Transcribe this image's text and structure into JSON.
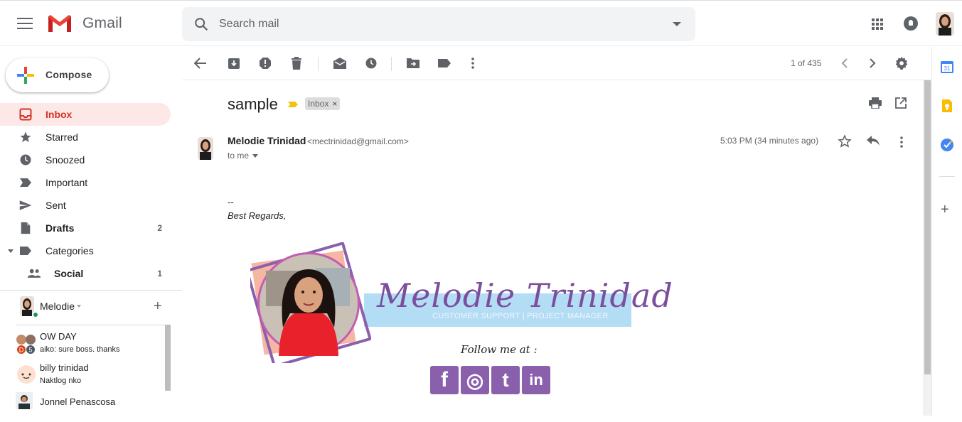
{
  "app": {
    "name": "Gmail"
  },
  "search": {
    "placeholder": "Search mail"
  },
  "compose": {
    "label": "Compose"
  },
  "nav": [
    {
      "label": "Inbox",
      "count": "",
      "icon": "inbox-icon"
    },
    {
      "label": "Starred",
      "count": "",
      "icon": "star-icon"
    },
    {
      "label": "Snoozed",
      "count": "",
      "icon": "clock-icon"
    },
    {
      "label": "Important",
      "count": "",
      "icon": "important-icon"
    },
    {
      "label": "Sent",
      "count": "",
      "icon": "send-icon"
    },
    {
      "label": "Drafts",
      "count": "2",
      "icon": "draft-icon"
    },
    {
      "label": "Categories",
      "count": "",
      "icon": "label-icon"
    },
    {
      "label": "Social",
      "count": "1",
      "icon": "people-icon"
    }
  ],
  "hangouts": {
    "user": "Melodie",
    "chats": [
      {
        "name": "OW DAY",
        "message": "aiko: sure boss. thanks",
        "badge_d": "D",
        "badge_n": "5"
      },
      {
        "name": "billy trinidad",
        "message": "Naktlog nko"
      },
      {
        "name": "Jonnel Penascosa",
        "message": ""
      }
    ]
  },
  "toolbar": {
    "pager": "1 of 435"
  },
  "email": {
    "subject": "sample",
    "label": "Inbox",
    "label_close": "×",
    "sender_name": "Melodie Trinidad",
    "sender_email": "<mectrinidad@gmail.com>",
    "to": "to me",
    "time": "5:03 PM (34 minutes ago)",
    "body_dash": "--",
    "body_regards": "Best Regards,"
  },
  "signature": {
    "name": "Melodie Trinidad",
    "title": "CUSTOMER SUPPORT | PROJECT MANAGER",
    "follow": "Follow me at :",
    "social": [
      {
        "name": "facebook",
        "glyph": "f"
      },
      {
        "name": "instagram",
        "glyph": "◎"
      },
      {
        "name": "twitter",
        "glyph": "t"
      },
      {
        "name": "linkedin",
        "glyph": "in"
      }
    ]
  },
  "colors": {
    "gmail_red": "#d93025",
    "active_bg": "#fce8e6",
    "signature_purple": "#7b4f9d",
    "signature_band": "#b3dcf5"
  }
}
